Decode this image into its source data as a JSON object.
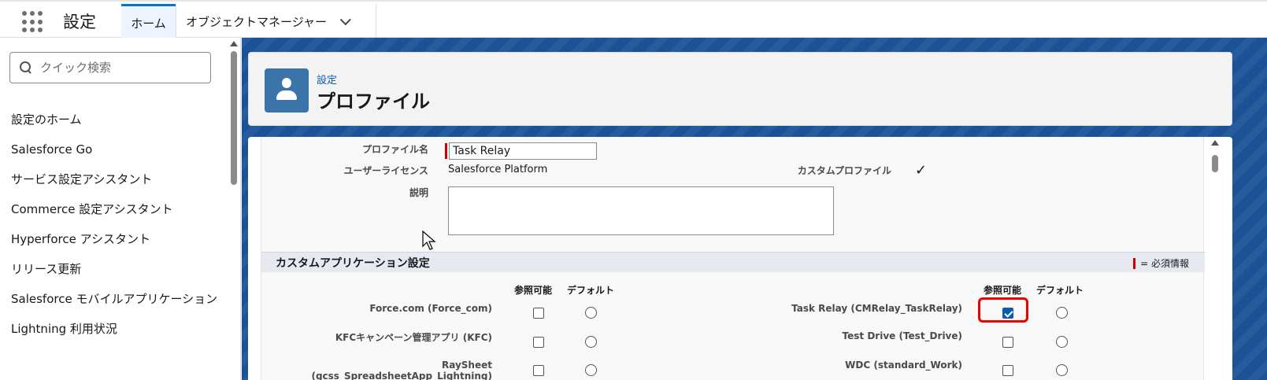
{
  "topbar": {
    "app_name": "設定",
    "tabs": [
      {
        "label": "ホーム"
      },
      {
        "label": "オブジェクトマネージャー"
      }
    ]
  },
  "sidebar": {
    "search": {
      "placeholder": "クイック検索",
      "value": ""
    },
    "items": [
      {
        "label": "設定のホーム"
      },
      {
        "label": "Salesforce Go"
      },
      {
        "label": "サービス設定アシスタント"
      },
      {
        "label": "Commerce 設定アシスタント"
      },
      {
        "label": "Hyperforce アシスタント"
      },
      {
        "label": "リリース更新"
      },
      {
        "label": "Salesforce モバイルアプリケーション"
      },
      {
        "label": "Lightning 利用状況"
      }
    ]
  },
  "header": {
    "breadcrumb": "設定",
    "title": "プロファイル"
  },
  "profile": {
    "name_label": "プロファイル名",
    "name_value": "Task Relay",
    "license_label": "ユーザーライセンス",
    "license_value": "Salesforce Platform",
    "custom_label": "カスタムプロファイル",
    "custom_value": "✓",
    "description_label": "説明",
    "description_value": ""
  },
  "custom_app_section": {
    "title": "カスタムアプリケーション設定",
    "required_legend": "= 必須情報",
    "col_visible": "参照可能",
    "col_default": "デフォルト",
    "left_apps": [
      {
        "label": "Force.com (Force_com)",
        "visible": false,
        "default": false
      },
      {
        "label": "KFCキャンペーン管理アプリ (KFC)",
        "visible": false,
        "default": false
      },
      {
        "label": "RaySheet (gcss_SpreadsheetApp_Lightning)",
        "visible": false,
        "default": false
      }
    ],
    "right_apps": [
      {
        "label": "Task Relay (CMRelay_TaskRelay)",
        "visible": true,
        "default": false
      },
      {
        "label": "Test Drive (Test_Drive)",
        "visible": false,
        "default": false
      },
      {
        "label": "WDC (standard_Work)",
        "visible": false,
        "default": false
      }
    ]
  },
  "colors": {
    "brand": "#0176d3",
    "background": "#1b5297",
    "highlight": "#e00000"
  }
}
